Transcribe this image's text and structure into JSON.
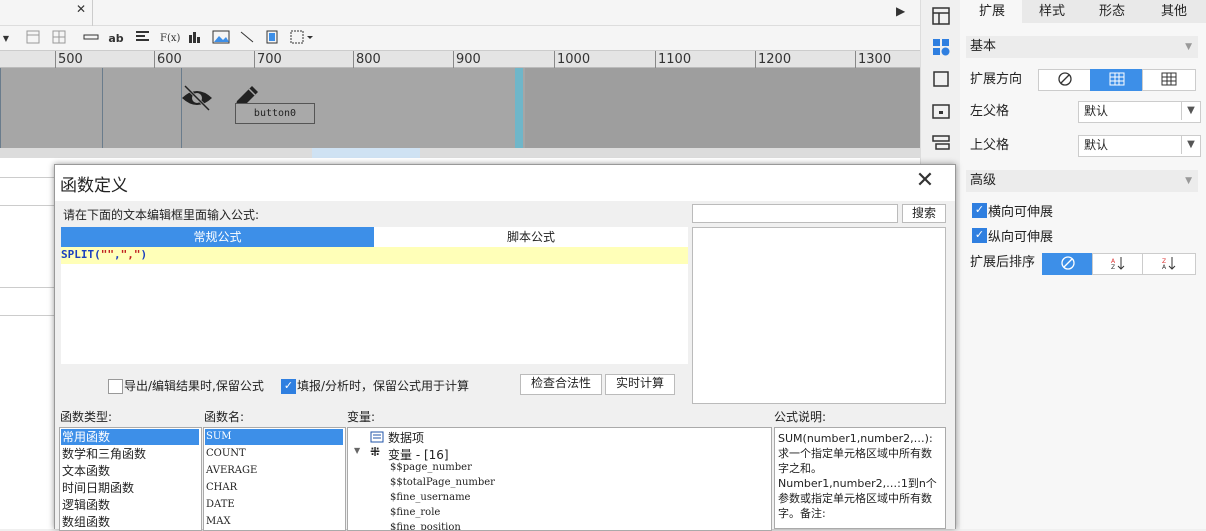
{
  "toolbar": {
    "icons": [
      "format-icon",
      "grid-icon",
      "line-icon",
      "text-icon",
      "align-icon",
      "formula-icon",
      "chart-icon",
      "image-icon",
      "slash-icon",
      "page-icon",
      "border-icon"
    ],
    "labels": {
      "text": "ab",
      "formula": "F(x)"
    }
  },
  "ruler": {
    "ticks": [
      "500",
      "600",
      "700",
      "800",
      "900",
      "1000",
      "1100",
      "1200",
      "1300"
    ]
  },
  "canvas": {
    "button_label": "button0"
  },
  "right_panel": {
    "tabs": [
      "扩展",
      "样式",
      "形态",
      "其他"
    ],
    "active_tab": "扩展",
    "basic": {
      "title": "基本",
      "direction_label": "扩展方向",
      "left_parent_label": "左父格",
      "left_parent_value": "默认",
      "top_parent_label": "上父格",
      "top_parent_value": "默认"
    },
    "advanced": {
      "title": "高级",
      "h_expand_label": "横向可伸展",
      "v_expand_label": "纵向可伸展",
      "sort_label": "扩展后排序"
    }
  },
  "dialog": {
    "title": "函数定义",
    "prompt": "请在下面的文本编辑框里面输入公式:",
    "tabs": {
      "normal": "常规公式",
      "script": "脚本公式"
    },
    "formula": {
      "fn": "SPLIT(",
      "arg1": "\"\"",
      "sep": ",",
      "arg2": "\",\"",
      "close": ")"
    },
    "search_button": "搜索",
    "options": {
      "keep_on_export": "导出/编辑结果时,保留公式",
      "keep_on_fill": "填报/分析时，保留公式用于计算"
    },
    "check_button": "检查合法性",
    "realtime_button": "实时计算",
    "columns": {
      "type": "函数类型:",
      "name": "函数名:",
      "variable": "变量:",
      "desc": "公式说明:"
    },
    "function_types": [
      "常用函数",
      "数学和三角函数",
      "文本函数",
      "时间日期函数",
      "逻辑函数",
      "数组函数"
    ],
    "function_names": [
      "SUM",
      "COUNT",
      "AVERAGE",
      "CHAR",
      "DATE",
      "MAX"
    ],
    "variables": {
      "data_item": "数据项",
      "var_group": "变量 - [16]",
      "items": [
        "$$page_number",
        "$$totalPage_number",
        "$fine_username",
        "$fine_role",
        "$fine_position"
      ]
    },
    "description": "SUM(number1,number2,…):求一个指定单元格区域中所有数字之和。Number1,number2,…:1到n个参数或指定单元格区域中所有数字。备注:"
  }
}
